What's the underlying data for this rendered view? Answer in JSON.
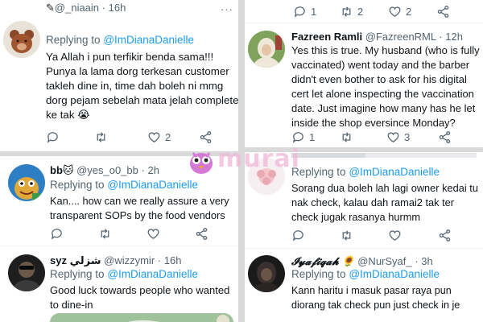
{
  "watermark": {
    "text": "murai",
    "color": "#f0b8d8"
  },
  "left_panel": {
    "t1": {
      "display_name": "",
      "handle": "@_niaain",
      "time": "16h",
      "reply_prefix": "Replying to",
      "reply_to": "@ImDianaDanielle",
      "lines": [
        "Ya Allah i pun terfikir benda sama!!!",
        "Punya la lama dorg terkesan customer",
        "takleh dine in, time dah boleh ni mmg",
        "dorg pejam sebelah mata jelah complete",
        "ke tak 😭"
      ],
      "likes": "2"
    },
    "t2": {
      "display_name": "bb🐱",
      "handle": "@yes_o0_bb",
      "time": "2h",
      "reply_prefix": "Replying to",
      "reply_to": "@ImDianaDanielle",
      "lines": [
        "Kan.... how can we really assure a very",
        "transparent SOPs by the food vendors"
      ]
    },
    "t3": {
      "display_name": "syz",
      "display_name_extra": "شزلي",
      "handle": "@wizzymir",
      "time": "16h",
      "reply_prefix": "Replying to",
      "reply_to": "@ImDianaDanielle",
      "lines": [
        "Good luck towards people who wanted",
        "to dine-in"
      ]
    }
  },
  "right_panel": {
    "t0": {
      "replies": "1",
      "retweets": "2",
      "likes": "2"
    },
    "t1": {
      "display_name": "Fazreen Ramli",
      "handle": "@FazreenRML",
      "time": "12h",
      "lines": [
        "Yes this is true. My husband (who is fully",
        "vaccinated) went today and the barber",
        "didn't even bother to ask for his digital",
        "cert let alone inspecting the vaccination",
        "date. Just imagine how many has he let",
        "inside the shop eversince Monday?"
      ],
      "replies": "1",
      "likes": "3"
    },
    "t2": {
      "reply_prefix": "Replying to",
      "reply_to": "@ImDianaDanielle",
      "lines": [
        "Sorang dua boleh lah lagi owner kedai tu",
        "nak check, kalau dah ramai2 tak ter",
        "check jugak rasanya hurmm"
      ]
    },
    "t3": {
      "display_name": "𝓘𝔂𝓪𝓯𝓲𝓺𝓪𝓱 🌻",
      "handle": "@NurSyaf_",
      "time": "3h",
      "reply_prefix": "Replying to",
      "reply_to": "@ImDianaDanielle",
      "lines": [
        "Kann haritu i masuk pasar raya pun",
        "diorang tak check pun just check in je"
      ]
    }
  }
}
